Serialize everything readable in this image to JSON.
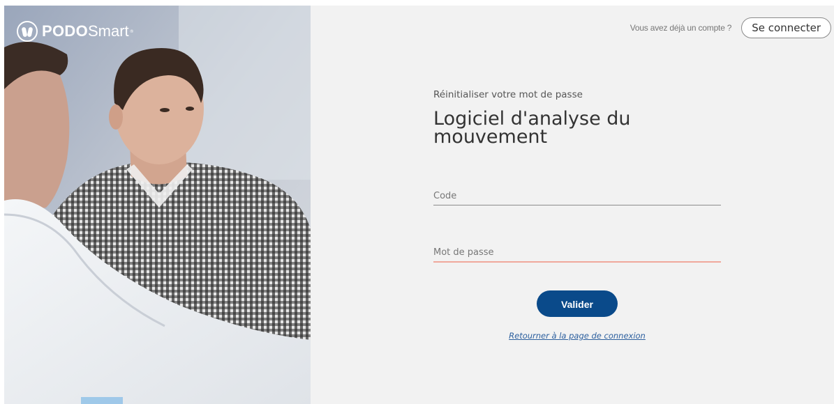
{
  "brand": {
    "name_bold": "PODO",
    "name_light": "Smart",
    "trademark": "®",
    "logo_icon": "podosmart-feet-logo-icon"
  },
  "topbar": {
    "have_account_text": "Vous avez déjà un compte ?",
    "connect_label": "Se connecter"
  },
  "form": {
    "subtitle": "Réinitialiser votre mot de passe",
    "title_line1": "Logiciel d'analyse du",
    "title_line2": "mouvement",
    "code_field": {
      "placeholder": "Code",
      "value": ""
    },
    "password_field": {
      "placeholder": "Mot de passe",
      "value": "",
      "status": "error"
    },
    "submit_label": "Valider",
    "back_link_label": "Retourner à la page de connexion"
  },
  "colors": {
    "primary_button": "#0a4a8a",
    "link": "#2c5f9e",
    "error_underline": "#f0a89c",
    "background": "#f2f2f2"
  },
  "hero": {
    "image": "two-men-consultation-photo"
  }
}
